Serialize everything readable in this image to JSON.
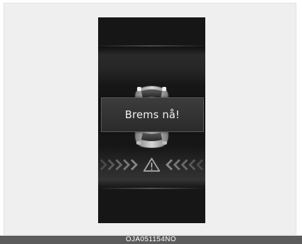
{
  "cluster_display": {
    "warning_message": "Brems nå!",
    "icons": {
      "vehicle": "car-rear-view-icon",
      "hazard": "warning-triangle-icon",
      "left_arrows": "chevrons-right-icon",
      "right_arrows": "chevrons-left-icon"
    },
    "colors": {
      "screen_background": "#161616",
      "popup_background": "#333333",
      "popup_text": "#f2f2f2",
      "chevrons": "#8a8a8a"
    }
  },
  "caption": {
    "code": "OJA051154NO"
  }
}
